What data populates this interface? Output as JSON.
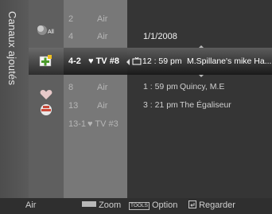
{
  "title": "Canaux ajoutés",
  "categories": [
    {
      "icon": "all-channels-icon",
      "label": "All"
    },
    {
      "icon": "added-channels-icon",
      "label": ""
    },
    {
      "icon": "favorite-heart-icon",
      "label": ""
    },
    {
      "icon": "programmed-clock-icon",
      "label": ""
    }
  ],
  "channels": [
    {
      "number": "2",
      "name": "Air"
    },
    {
      "number": "4",
      "name": "Air"
    },
    {
      "number": "4-2",
      "name": "♥ TV #8",
      "selected": true
    },
    {
      "number": "8",
      "name": "Air"
    },
    {
      "number": "13",
      "name": "Air"
    },
    {
      "number": "13-1",
      "name": "♥ TV #3"
    }
  ],
  "guide": {
    "date": "1/1/2008",
    "selected": {
      "time": "12 : 59 pm",
      "title": "M.Spillane's mike Ha..."
    },
    "programs": [
      {
        "time": "1 : 59 pm",
        "title": "Quincy, M.E"
      },
      {
        "time": "3 : 21 pm",
        "title": "The Égaliseur"
      }
    ]
  },
  "bottom_bar": {
    "antenna": "Air",
    "zoom": "Zoom",
    "tools_badge": "TOOLS",
    "option": "Option",
    "watch": "Regarder"
  },
  "colors": {
    "zoom_key": "#b8b8b8"
  }
}
